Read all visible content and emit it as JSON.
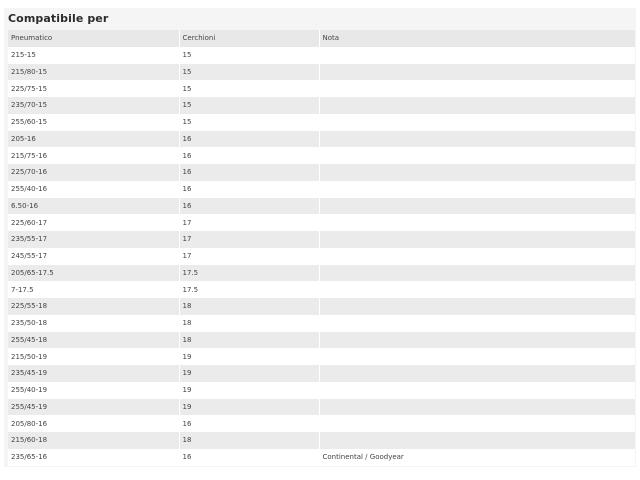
{
  "section": {
    "title": "Compatibile per"
  },
  "table": {
    "headers": [
      "Pneumatico",
      "Cerchioni",
      "Nota"
    ],
    "rows": [
      [
        "215-15",
        "15",
        ""
      ],
      [
        "215/80-15",
        "15",
        ""
      ],
      [
        "225/75-15",
        "15",
        ""
      ],
      [
        "235/70-15",
        "15",
        ""
      ],
      [
        "255/60-15",
        "15",
        ""
      ],
      [
        "205-16",
        "16",
        ""
      ],
      [
        "215/75-16",
        "16",
        ""
      ],
      [
        "225/70-16",
        "16",
        ""
      ],
      [
        "255/40-16",
        "16",
        ""
      ],
      [
        "6.50-16",
        "16",
        ""
      ],
      [
        "225/60-17",
        "17",
        ""
      ],
      [
        "235/55-17",
        "17",
        ""
      ],
      [
        "245/55-17",
        "17",
        ""
      ],
      [
        "205/65-17.5",
        "17.5",
        ""
      ],
      [
        "7-17.5",
        "17.5",
        ""
      ],
      [
        "225/55-18",
        "18",
        ""
      ],
      [
        "235/50-18",
        "18",
        ""
      ],
      [
        "255/45-18",
        "18",
        ""
      ],
      [
        "215/50-19",
        "19",
        ""
      ],
      [
        "235/45-19",
        "19",
        ""
      ],
      [
        "255/40-19",
        "19",
        ""
      ],
      [
        "255/45-19",
        "19",
        ""
      ],
      [
        "205/80-16",
        "16",
        ""
      ],
      [
        "215/60-18",
        "18",
        ""
      ],
      [
        "235/65-16",
        "16",
        "Continental / Goodyear"
      ]
    ]
  },
  "colors": {
    "panel_bg": "#f5f5f5",
    "row_odd": "#ffffff",
    "row_even": "#ebebeb",
    "header_bg": "#e8e8e8"
  }
}
